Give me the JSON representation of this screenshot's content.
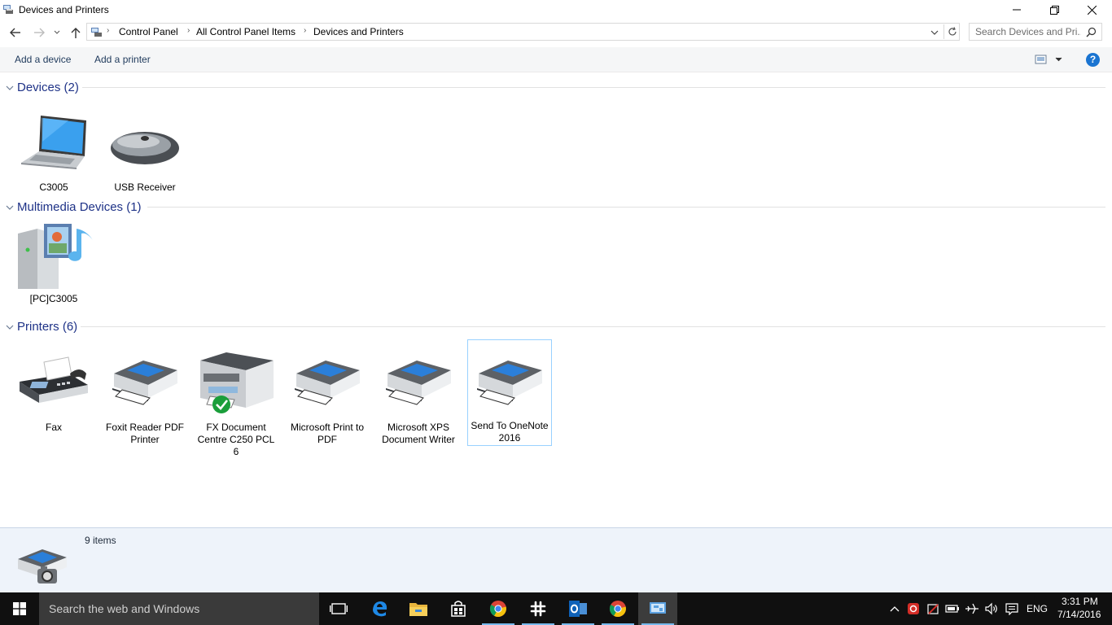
{
  "window": {
    "title": "Devices and Printers"
  },
  "address": {
    "crumbs": [
      "Control Panel",
      "All Control Panel Items",
      "Devices and Printers"
    ],
    "search_placeholder": "Search Devices and Pri..."
  },
  "commands": {
    "add_device": "Add a device",
    "add_printer": "Add a printer",
    "help": "?"
  },
  "groups": {
    "devices": {
      "title": "Devices (2)",
      "items": [
        {
          "label": "C3005",
          "icon": "laptop-icon"
        },
        {
          "label": "USB Receiver",
          "icon": "mouse-icon"
        }
      ]
    },
    "multimedia": {
      "title": "Multimedia Devices (1)",
      "items": [
        {
          "label": "[PC]C3005",
          "icon": "media-server-icon"
        }
      ]
    },
    "printers": {
      "title": "Printers (6)",
      "items": [
        {
          "label": "Fax",
          "icon": "fax-icon"
        },
        {
          "label": "Foxit Reader PDF Printer",
          "icon": "printer-icon"
        },
        {
          "label": "FX Document Centre C250 PCL 6",
          "icon": "mfp-printer-icon",
          "default": true
        },
        {
          "label": "Microsoft Print to PDF",
          "icon": "printer-icon"
        },
        {
          "label": "Microsoft XPS Document Writer",
          "icon": "printer-icon"
        },
        {
          "label": "Send To OneNote 2016",
          "icon": "printer-icon",
          "selected": true
        }
      ]
    }
  },
  "details": {
    "count_text": "9 items"
  },
  "taskbar": {
    "search_placeholder": "Search the web and Windows",
    "apps": [
      "task-view-icon",
      "edge-icon",
      "file-explorer-icon",
      "store-icon",
      "chrome-icon",
      "slack-icon",
      "outlook-icon",
      "chrome-icon",
      "devices-printers-icon"
    ],
    "language": "ENG",
    "time": "3:31 PM",
    "date": "7/14/2016"
  },
  "colors": {
    "accent": "#1e3287",
    "selection_border": "#99d1ff",
    "taskbar": "#101010",
    "default_check": "#1a9e3a"
  }
}
